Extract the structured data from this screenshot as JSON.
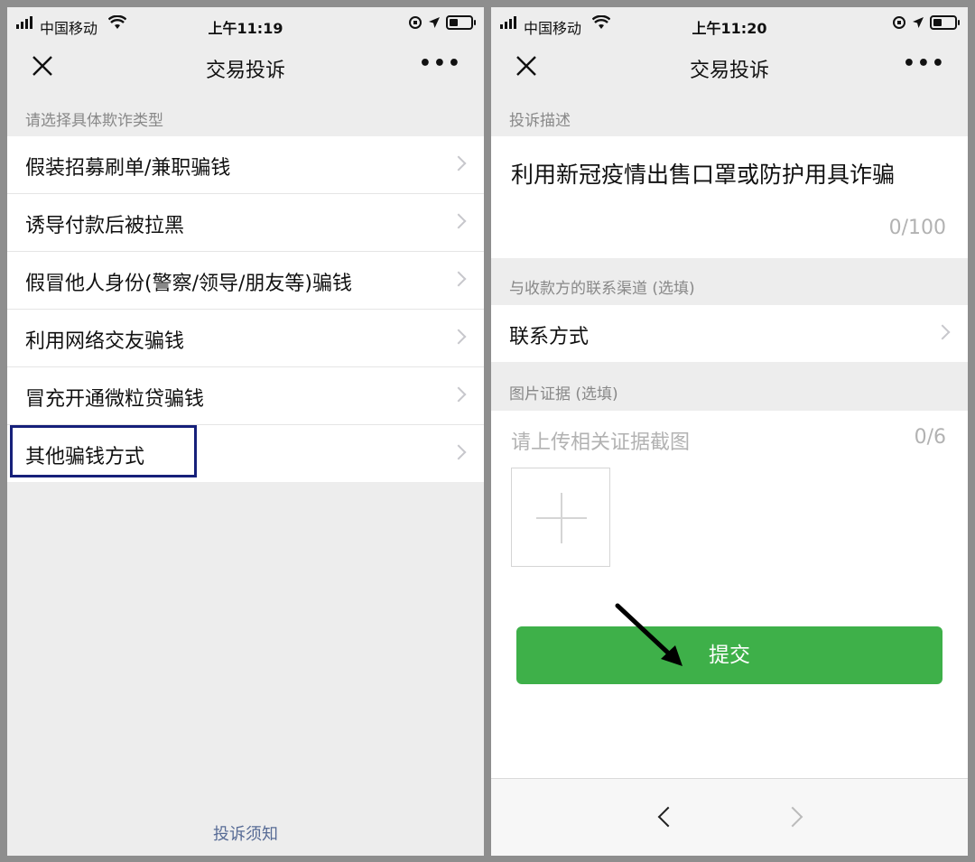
{
  "screens": [
    {
      "status": {
        "carrier": "中国移动",
        "time": "上午11:19"
      },
      "nav": {
        "title": "交易投诉",
        "more": "•••"
      },
      "section_label": "请选择具体欺诈类型",
      "options": [
        {
          "label": "假装招募刷单/兼职骗钱"
        },
        {
          "label": "诱导付款后被拉黑"
        },
        {
          "label": "假冒他人身份(警察/领导/朋友等)骗钱"
        },
        {
          "label": "利用网络交友骗钱"
        },
        {
          "label": "冒充开通微粒贷骗钱"
        },
        {
          "label": "其他骗钱方式"
        }
      ],
      "highlighted_option": "其他骗钱方式",
      "footer_link": "投诉须知"
    },
    {
      "status": {
        "carrier": "中国移动",
        "time": "上午11:20"
      },
      "nav": {
        "title": "交易投诉",
        "more": "•••"
      },
      "description": {
        "label": "投诉描述",
        "text": "利用新冠疫情出售口罩或防护用具诈骗",
        "count": "0/100"
      },
      "contact": {
        "label": "与收款方的联系渠道 (选填)",
        "row_label": "联系方式"
      },
      "evidence": {
        "label": "图片证据 (选填)",
        "placeholder": "请上传相关证据截图",
        "count": "0/6"
      },
      "submit_label": "提交"
    }
  ],
  "colors": {
    "primary_green": "#3eb049",
    "highlight_border": "#16207a",
    "link_blue": "#576b95"
  },
  "icons": [
    "signal-icon",
    "wifi-icon",
    "orientation-lock-icon",
    "location-icon",
    "battery-icon",
    "close-icon",
    "more-icon",
    "chevron-right-icon",
    "add-photo-icon",
    "arrow-annotation-icon",
    "back-icon",
    "forward-icon"
  ]
}
